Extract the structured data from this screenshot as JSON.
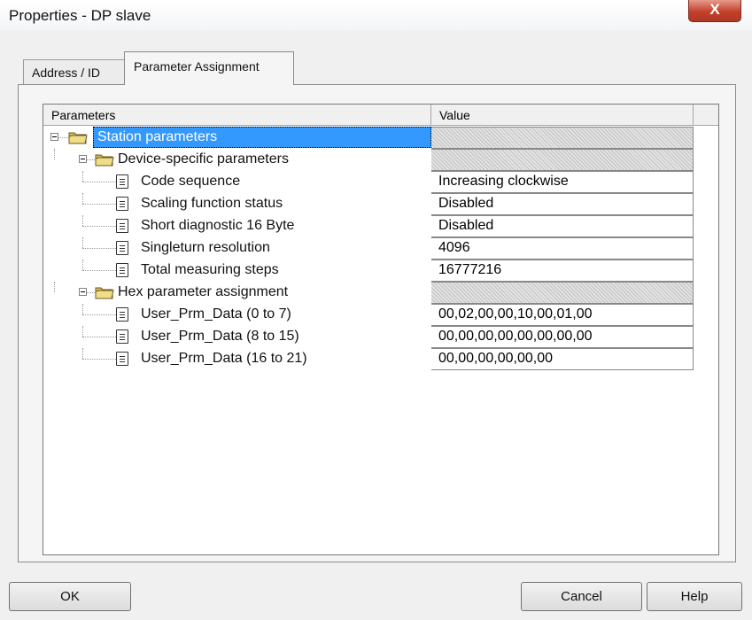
{
  "window": {
    "title": "Properties - DP slave",
    "close_glyph": "X"
  },
  "tabs": [
    {
      "label": "Address / ID"
    },
    {
      "label": "Parameter Assignment"
    }
  ],
  "grid": {
    "columns": [
      "Parameters",
      "Value"
    ],
    "rows": [
      {
        "label": "Station parameters",
        "value": "",
        "type": "folder",
        "level": 0
      },
      {
        "label": "Device-specific parameters",
        "value": "",
        "type": "folder",
        "level": 1
      },
      {
        "label": "Code sequence",
        "value": "Increasing clockwise",
        "type": "item",
        "level": 2
      },
      {
        "label": "Scaling function status",
        "value": "Disabled",
        "type": "item",
        "level": 2
      },
      {
        "label": "Short diagnostic 16 Byte",
        "value": "Disabled",
        "type": "item",
        "level": 2
      },
      {
        "label": "Singleturn resolution",
        "value": "4096",
        "type": "item",
        "level": 2
      },
      {
        "label": "Total measuring steps",
        "value": "16777216",
        "type": "item",
        "level": 2
      },
      {
        "label": "Hex parameter assignment",
        "value": "",
        "type": "folder",
        "level": 1
      },
      {
        "label": "User_Prm_Data (0 to 7)",
        "value": "00,02,00,00,10,00,01,00",
        "type": "item",
        "level": 2
      },
      {
        "label": "User_Prm_Data (8 to 15)",
        "value": "00,00,00,00,00,00,00,00",
        "type": "item",
        "level": 2
      },
      {
        "label": "User_Prm_Data (16 to 21)",
        "value": "00,00,00,00,00,00",
        "type": "item",
        "level": 2
      }
    ]
  },
  "buttons": {
    "ok": "OK",
    "cancel": "Cancel",
    "help": "Help"
  },
  "colors": {
    "selection": "#3399ff",
    "close_button": "#c3402a"
  }
}
